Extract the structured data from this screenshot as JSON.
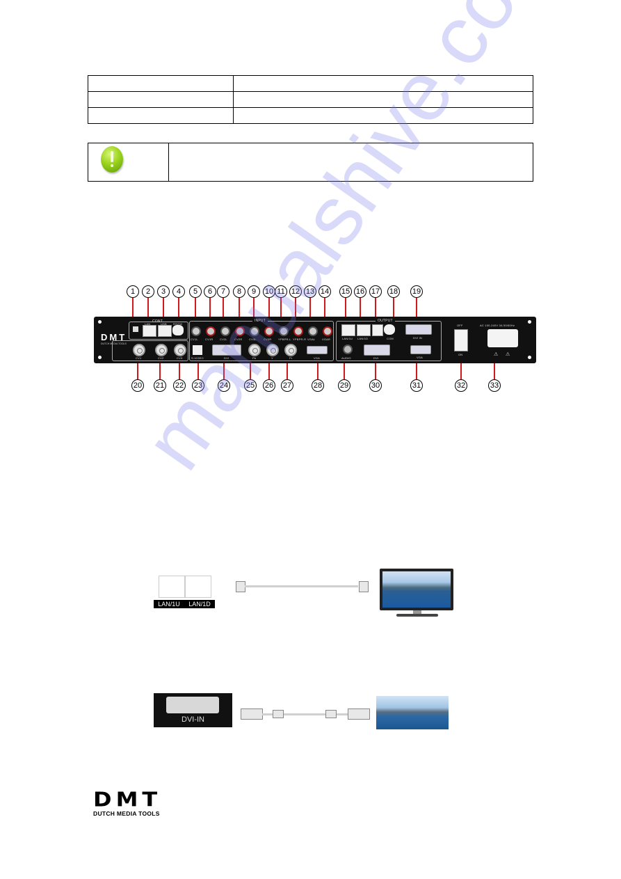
{
  "spec_table": {
    "rows": [
      [
        "",
        ""
      ],
      [
        "",
        ""
      ],
      [
        "",
        ""
      ]
    ]
  },
  "note": {
    "icon": "exclamation-icon",
    "text": ""
  },
  "watermark": "manualshive.com",
  "rear_panel": {
    "brand": "DMT",
    "brand_sub": "DUTCH MEDIA TOOLS",
    "groups": {
      "control": "CONT",
      "input": "INPUT",
      "output": "OUTPUT"
    },
    "labels": {
      "lan": "LAN",
      "usb": "USB",
      "rs232": "RS232",
      "cv1l": "CV1L",
      "cv1r": "CV1R",
      "cv2l": "CV2L",
      "cv2r": "CV2R",
      "cv3l": "CV3L",
      "cv3r": "CV3R",
      "ypbprl": "YPBPR-L",
      "ypbprr": "YPBPR-R",
      "vgal": "VGAL",
      "vgar": "VGAR",
      "cv1": "CV1",
      "cv2": "CV2",
      "cv3": "CV3",
      "svideo": "S-VIDEO",
      "dvi_in_input": "DVI",
      "pb": "Pb",
      "y": "Y",
      "pr": "Pr",
      "vga_in": "VGA",
      "lan1u": "LAN/1U",
      "lan1d": "LAN/1D",
      "com": "COM",
      "dvi_in": "DVI IN",
      "audio": "AUDIO",
      "dvi_out": "DVI",
      "vga_out": "VGA",
      "off": "OFF",
      "on": "ON",
      "power_rating": "AC 100-240V 3A 50/60Hz"
    },
    "callouts_top": [
      "1",
      "2",
      "3",
      "4",
      "5",
      "6",
      "7",
      "8",
      "9",
      "10",
      "11",
      "12",
      "13",
      "14",
      "15",
      "16",
      "17",
      "18",
      "19"
    ],
    "callouts_bottom": [
      "20",
      "21",
      "22",
      "23",
      "24",
      "25",
      "26",
      "27",
      "28",
      "29",
      "30",
      "31",
      "32",
      "33"
    ]
  },
  "lan_diagram": {
    "port_labels": [
      "LAN/1U",
      "LAN/1D"
    ]
  },
  "dvi_diagram": {
    "port_label": "DVI-IN"
  },
  "footer_logo": {
    "brand": "DMT",
    "tagline": "DUTCH MEDIA TOOLS"
  }
}
